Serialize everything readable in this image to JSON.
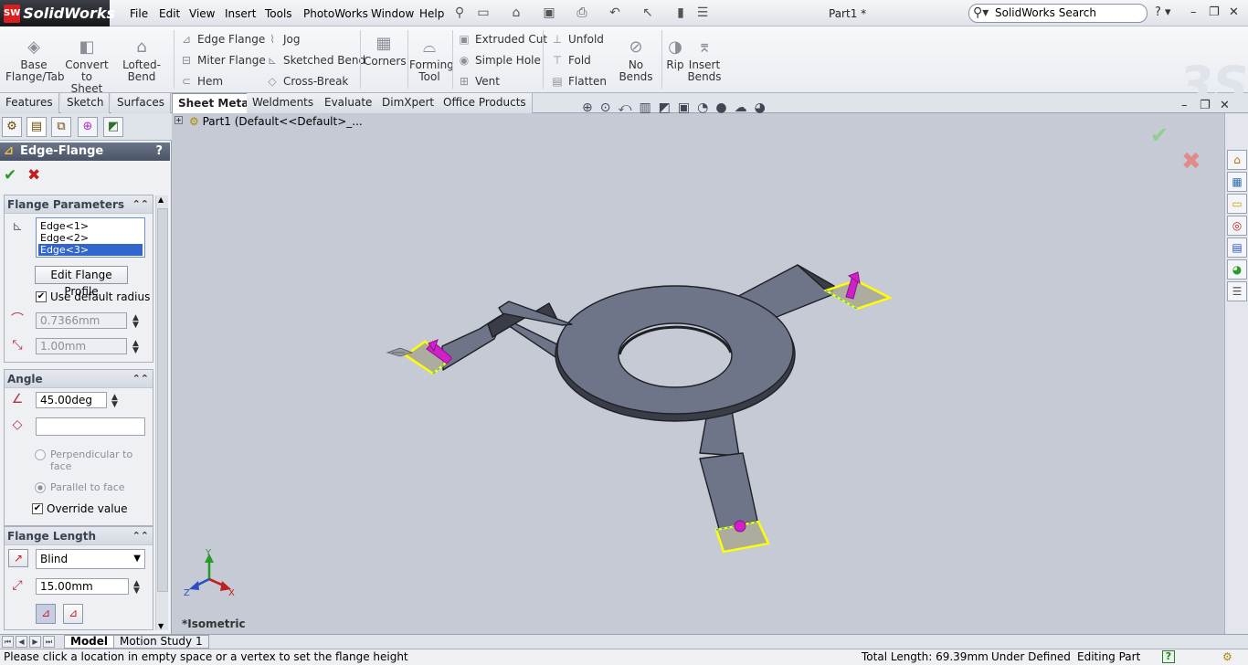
{
  "app": {
    "brand": "SolidWorks",
    "doc_title": "Part1 *"
  },
  "menu": [
    "File",
    "Edit",
    "View",
    "Insert",
    "Tools",
    "PhotoWorks",
    "Window",
    "Help"
  ],
  "search": {
    "placeholder": "SolidWorks Search"
  },
  "ribbon": {
    "base_flange": "Base Flange/Tab",
    "convert_to_sheet_metal": "Convert to Sheet Metal",
    "lofted_bend": "Lofted-Bend",
    "edge_flange": "Edge Flange",
    "miter_flange": "Miter Flange",
    "hem": "Hem",
    "jog": "Jog",
    "sketched_bend": "Sketched Bend",
    "cross_break": "Cross-Break",
    "corners": "Corners",
    "forming_tool": "Forming Tool",
    "extruded_cut": "Extruded Cut",
    "simple_hole": "Simple Hole",
    "vent": "Vent",
    "unfold": "Unfold",
    "fold": "Fold",
    "flatten": "Flatten",
    "no_bends": "No Bends",
    "rip": "Rip",
    "insert_bends": "Insert Bends"
  },
  "tabs": [
    "Features",
    "Sketch",
    "Surfaces",
    "Sheet Metal",
    "Weldments",
    "Evaluate",
    "DimXpert",
    "Office Products"
  ],
  "active_tab": "Sheet Metal",
  "property_manager": {
    "title": "Edge-Flange",
    "help": "?",
    "ok": "✔",
    "cancel": "✖",
    "flange_parameters": {
      "header": "Flange Parameters",
      "edges": [
        "Edge<1>",
        "Edge<2>",
        "Edge<3>"
      ],
      "selected_edge": "Edge<3>",
      "edit_profile": "Edit Flange Profile",
      "use_default_radius": "Use default radius",
      "radius": "0.7366mm",
      "gap": "1.00mm"
    },
    "angle": {
      "header": "Angle",
      "value": "45.00deg",
      "perpendicular": "Perpendicular to face",
      "parallel": "Parallel to face",
      "override": "Override value"
    },
    "flange_length": {
      "header": "Flange Length",
      "end_condition": "Blind",
      "length": "15.00mm"
    }
  },
  "tree": {
    "part": "Part1  (Default<<Default>_..."
  },
  "viewport": {
    "view_label": "*Isometric",
    "triad": {
      "x": "X",
      "y": "Y",
      "z": "Z"
    }
  },
  "bottom_tabs": [
    "Model",
    "Motion Study 1"
  ],
  "status": {
    "message": "Please click a location in empty space or a vertex to set the flange height",
    "total_length": "Total Length: 69.39mm",
    "definition": "Under Defined",
    "mode": "Editing Part",
    "help": "?"
  },
  "colors": {
    "model": "#6f7588",
    "model_edge": "#1e2026",
    "highlight": "#ffff00",
    "arrow": "#d020c8",
    "background": "#c5cad4"
  }
}
